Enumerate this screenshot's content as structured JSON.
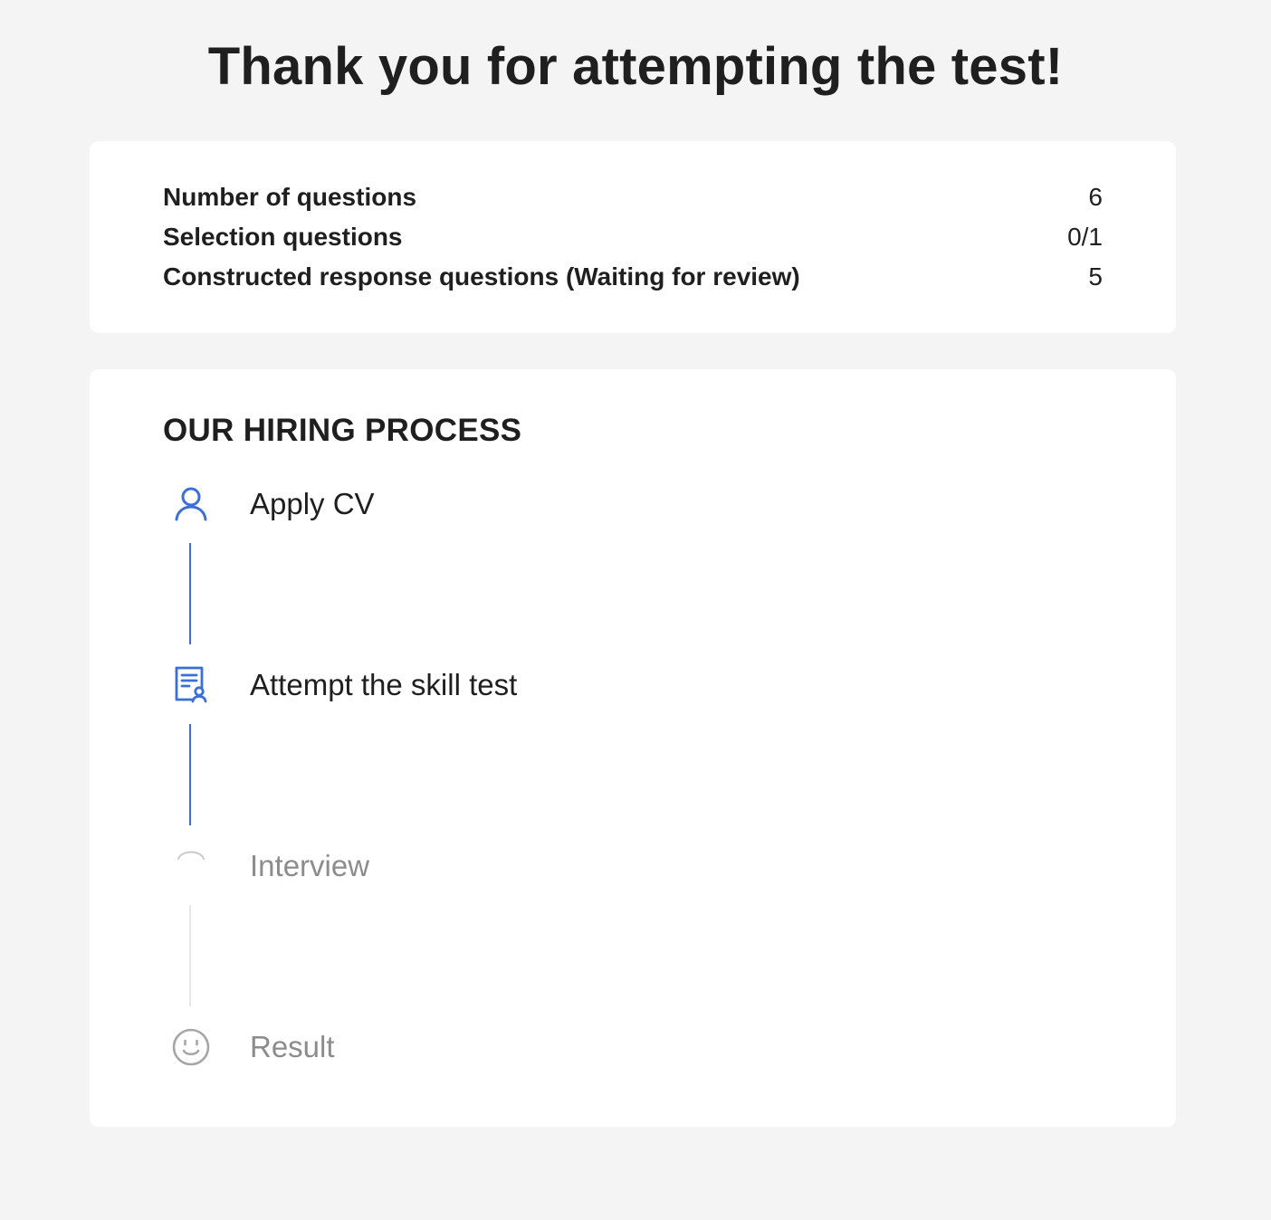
{
  "page": {
    "title": "Thank you for attempting the test!"
  },
  "summary": {
    "rows": [
      {
        "label": "Number of questions",
        "value": "6"
      },
      {
        "label": "Selection questions",
        "value": "0/1"
      },
      {
        "label": "Constructed response questions (Waiting for review)",
        "value": "5"
      }
    ]
  },
  "process": {
    "title": "OUR HIRING PROCESS",
    "steps": [
      {
        "label": "Apply CV",
        "status": "done",
        "icon": "user-icon"
      },
      {
        "label": "Attempt the skill test",
        "status": "done",
        "icon": "test-certificate-icon"
      },
      {
        "label": "Interview",
        "status": "pending",
        "icon": "loading-spinner-icon"
      },
      {
        "label": "Result",
        "status": "pending",
        "icon": "smiley-icon"
      }
    ]
  },
  "colors": {
    "background": "#f4f4f4",
    "card": "#ffffff",
    "accent": "#3b6fd8",
    "text": "#1f1f1f",
    "muted": "#8c8c8c",
    "connector_inactive": "#e6e6e6"
  }
}
